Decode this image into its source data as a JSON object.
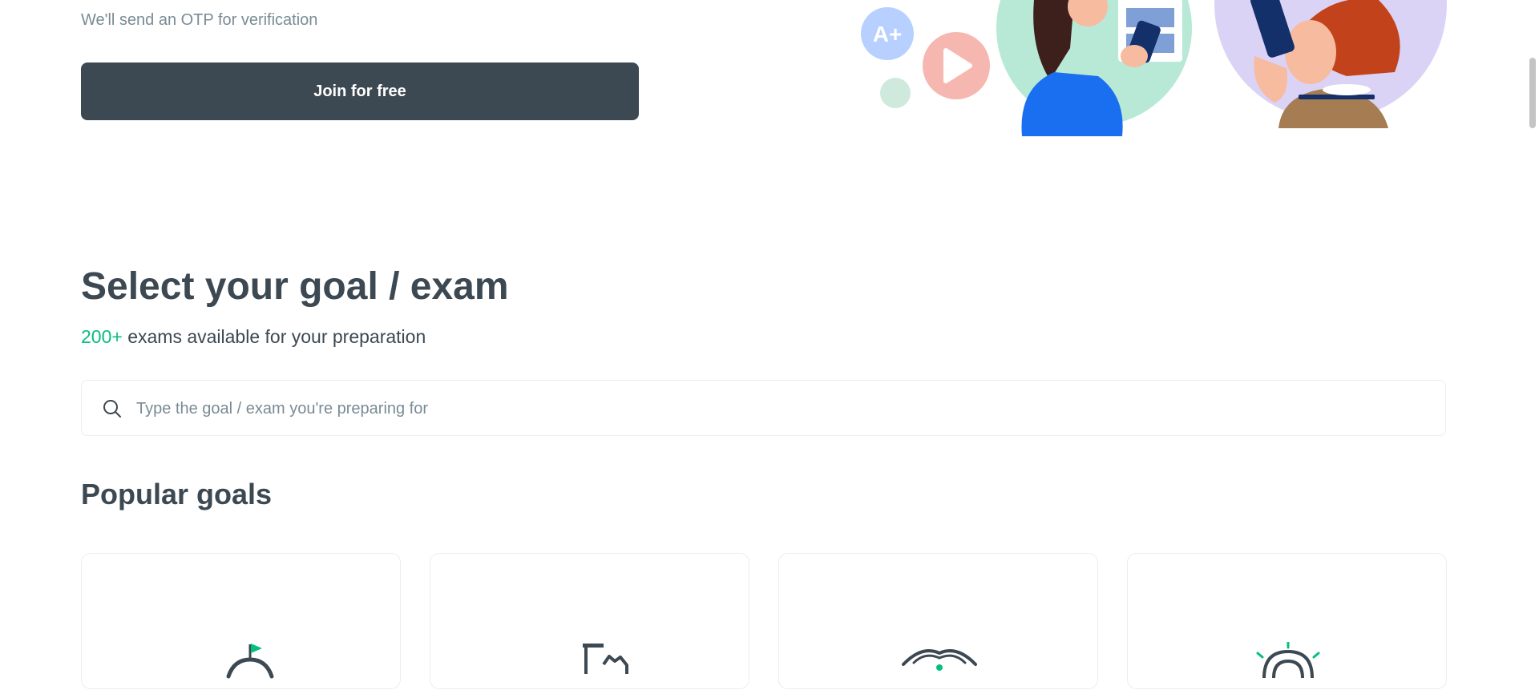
{
  "signup": {
    "otp_note": "We'll send an OTP for verification",
    "join_label": "Join for free"
  },
  "hero": {
    "badge_text": "A+",
    "icons": [
      "grade-badge-icon",
      "play-icon",
      "dot-icon"
    ]
  },
  "goal_section": {
    "title": "Select your goal / exam",
    "count": "200+",
    "subtitle_rest": " exams available for your preparation"
  },
  "search": {
    "placeholder": "Type the goal / exam you're preparing for",
    "icon": "search-icon"
  },
  "popular": {
    "title": "Popular goals",
    "cards": [
      {
        "icon": "stopwatch-flag-icon"
      },
      {
        "icon": "building-icon"
      },
      {
        "icon": "lamp-icon"
      },
      {
        "icon": "target-icon"
      }
    ]
  },
  "colors": {
    "primary": "#3c4852",
    "accent_green": "#08bd80",
    "muted_text": "#7a8b94",
    "border": "#e9eef2"
  }
}
